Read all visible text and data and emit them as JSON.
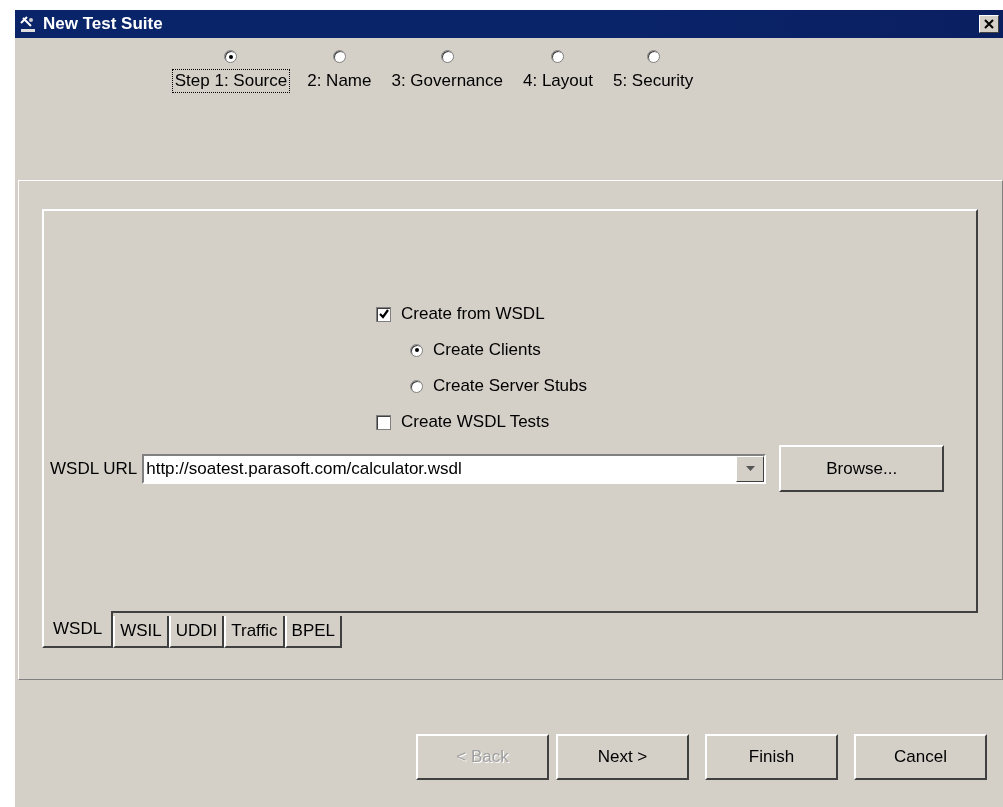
{
  "window": {
    "title": "New Test Suite"
  },
  "steps": [
    {
      "label": "Step 1: Source",
      "selected": true
    },
    {
      "label": "2: Name",
      "selected": false
    },
    {
      "label": "3: Governance",
      "selected": false
    },
    {
      "label": "4: Layout",
      "selected": false
    },
    {
      "label": "5: Security",
      "selected": false
    }
  ],
  "options": [
    {
      "kind": "checkbox",
      "label": "Create from WSDL",
      "checked": true
    },
    {
      "kind": "radio",
      "label": "Create Clients",
      "selected": true
    },
    {
      "kind": "radio",
      "label": "Create Server Stubs",
      "selected": false
    },
    {
      "kind": "checkbox",
      "label": "Create WSDL Tests",
      "checked": false
    }
  ],
  "wsdl_url": {
    "label": "WSDL URL",
    "value": "http://soatest.parasoft.com/calculator.wsdl",
    "browse": "Browse..."
  },
  "tabs": [
    {
      "label": "WSDL",
      "selected": true
    },
    {
      "label": "WSIL",
      "selected": false
    },
    {
      "label": "UDDI",
      "selected": false
    },
    {
      "label": "Traffic",
      "selected": false
    },
    {
      "label": "BPEL",
      "selected": false
    }
  ],
  "buttons": [
    {
      "label": "< Back",
      "disabled": true
    },
    {
      "label": "Next >",
      "disabled": false
    },
    {
      "label": "Finish",
      "disabled": false
    },
    {
      "label": "Cancel",
      "disabled": false
    }
  ]
}
